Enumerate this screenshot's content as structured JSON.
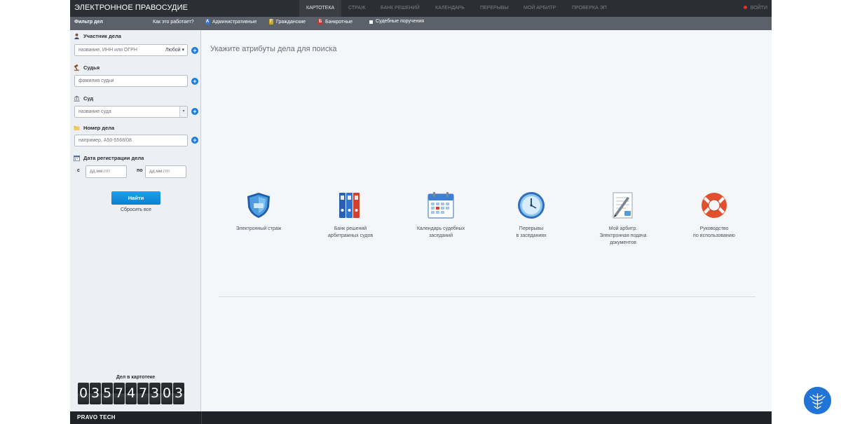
{
  "topbar": {
    "brand": "ЭЛЕКТРОННОЕ ПРАВОСУДИЕ",
    "nav": [
      {
        "label": "КАРТОТЕКА"
      },
      {
        "label": "СТРАЖ"
      },
      {
        "label": "БАНК РЕШЕНИЙ"
      },
      {
        "label": "КАЛЕНДАРЬ"
      },
      {
        "label": "ПЕРЕРЫВЫ"
      },
      {
        "label": "МОЙ АРБИТР"
      },
      {
        "label": "ПРОВЕРКА ЭП"
      }
    ],
    "login": "ВОЙТИ"
  },
  "filterbar": {
    "title": "Фильтр дел",
    "how": "Как это работает?",
    "types": [
      "Административные",
      "Гражданские",
      "Банкротные",
      "Судебные поручения"
    ]
  },
  "sidebar": {
    "participant_label": "Участник дела",
    "participant_placeholder": "название, ИНН или ОГРН",
    "participant_mode": "Любой",
    "judge_label": "Судья",
    "judge_placeholder": "фамилия судьи",
    "court_label": "Суд",
    "court_placeholder": "название суда",
    "case_label": "Номер дела",
    "case_placeholder": "например, А50-5568/08",
    "date_label": "Дата регистрации дела",
    "date_from_label": "с",
    "date_to_label": "по",
    "date_placeholder": "дд.мм.гггг",
    "find": "Найти",
    "reset": "Сбросить все",
    "counter_label": "Дел в картотеке",
    "counter_digits": [
      "0",
      "3",
      "5",
      "7",
      "4",
      "7",
      "3",
      "0",
      "3"
    ]
  },
  "main": {
    "title": "Укажите атрибуты дела для поиска",
    "services": [
      {
        "label1": "Электронный страж",
        "label2": "",
        "label3": "",
        "icon": "shield-icon"
      },
      {
        "label1": "Банк решений",
        "label2": "арбитражных судов",
        "label3": "",
        "icon": "binders-icon"
      },
      {
        "label1": "Календарь судебных",
        "label2": "заседаний",
        "label3": "",
        "icon": "calendar-icon"
      },
      {
        "label1": "Перерывы",
        "label2": "в заседаниях",
        "label3": "",
        "icon": "clock-icon"
      },
      {
        "label1": "Мой арбитр.",
        "label2": "Электронная подача",
        "label3": "документов",
        "icon": "document-pen-icon"
      },
      {
        "label1": "Руководство",
        "label2": "по использованию",
        "label3": "",
        "icon": "lifebuoy-icon"
      }
    ]
  },
  "footer": {
    "brand": "PRAVO TECH"
  },
  "colors": {
    "topbar": "#2b2e33",
    "filterbar": "#5b6069",
    "accent": "#1d7ed6",
    "button": "#0a7fd0"
  }
}
